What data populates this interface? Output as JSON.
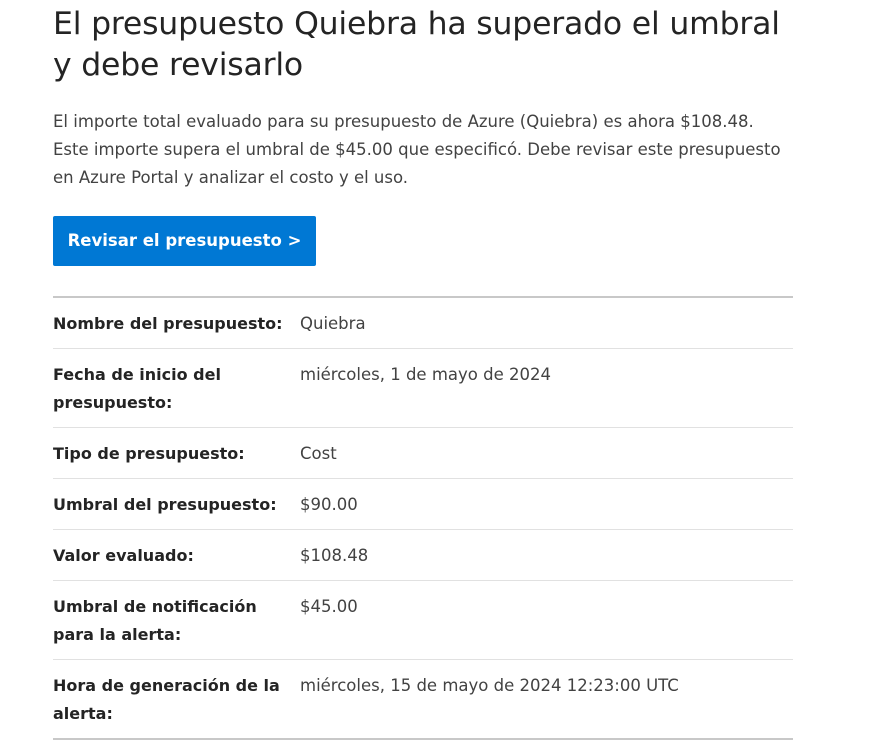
{
  "heading": "El presupuesto Quiebra ha superado el umbral y debe revisarlo",
  "intro": "El importe total evaluado para su presupuesto de Azure (Quiebra) es ahora $108.48. Este importe supera el umbral de $45.00 que especificó. Debe revisar este presupuesto en Azure Portal y analizar el costo y el uso.",
  "review_button": "Revisar el presupuesto >",
  "details": [
    {
      "label": "Nombre del presupuesto:",
      "value": "Quiebra"
    },
    {
      "label": "Fecha de inicio del presupuesto:",
      "value": "miércoles, 1 de mayo de 2024"
    },
    {
      "label": "Tipo de presupuesto:",
      "value": "Cost"
    },
    {
      "label": "Umbral del presupuesto:",
      "value": "$90.00"
    },
    {
      "label": "Valor evaluado:",
      "value": "$108.48"
    },
    {
      "label": "Umbral de notificación para la alerta:",
      "value": "$45.00"
    },
    {
      "label": "Hora de generación de la alerta:",
      "value": "miércoles, 15 de mayo de 2024 12:23:00 UTC"
    }
  ],
  "colors": {
    "button_bg": "#0078d4",
    "button_text": "#ffffff",
    "divider": "#c8c8c8"
  }
}
